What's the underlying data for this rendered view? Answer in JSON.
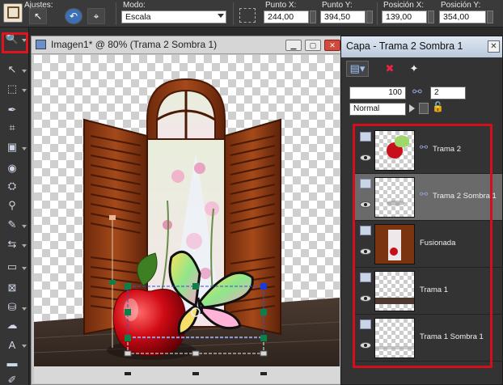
{
  "toolbar": {
    "ajustes_label": "Ajustes:",
    "modo_label": "Modo:",
    "modo_value": "Escala",
    "punto_x_label": "Punto X:",
    "punto_x_value": "244,00",
    "punto_y_label": "Punto Y:",
    "punto_y_value": "394,50",
    "posicion_x_label": "Posición X:",
    "posicion_x_value": "139,00",
    "posicion_y_label": "Posición Y:",
    "posicion_y_value": "354,00"
  },
  "tools": [
    {
      "name": "zoom-icon",
      "glyph": "🔍"
    },
    {
      "name": "pick-tool-icon",
      "glyph": "↖"
    },
    {
      "name": "selection-icon",
      "glyph": "⬚"
    },
    {
      "name": "dropper-icon",
      "glyph": "✒"
    },
    {
      "name": "crop-icon",
      "glyph": "⌗"
    },
    {
      "name": "straighten-icon",
      "glyph": "▣"
    },
    {
      "name": "red-eye-icon",
      "glyph": "◉"
    },
    {
      "name": "clone-icon",
      "glyph": "⛭"
    },
    {
      "name": "scratch-remover-icon",
      "glyph": "⚲"
    },
    {
      "name": "paint-brush-icon",
      "glyph": "✎"
    },
    {
      "name": "lighten-darken-icon",
      "glyph": "⇆"
    },
    {
      "name": "eraser-icon",
      "glyph": "▭"
    },
    {
      "name": "background-eraser-icon",
      "glyph": "⊠"
    },
    {
      "name": "flood-fill-icon",
      "glyph": "⛁"
    },
    {
      "name": "smudge-icon",
      "glyph": "☁"
    },
    {
      "name": "text-tool-icon",
      "glyph": "A"
    },
    {
      "name": "rectangle-tool-icon",
      "glyph": "▬"
    },
    {
      "name": "pen-tool-icon",
      "glyph": "✐"
    }
  ],
  "image_window": {
    "title": "Imagen1* @  80% (Trama 2 Sombra 1)"
  },
  "layers_panel": {
    "title": "Capa - Trama 2 Sombra 1",
    "opacity": "100",
    "link_set": "2",
    "blend_mode": "Normal",
    "layers": [
      {
        "name": "Trama 2",
        "selected": false,
        "linked": true
      },
      {
        "name": "Trama 2 Sombra 1",
        "selected": true,
        "linked": true
      },
      {
        "name": "Fusionada",
        "selected": false,
        "linked": false
      },
      {
        "name": "Trama 1",
        "selected": false,
        "linked": false
      },
      {
        "name": "Trama 1 Sombra 1",
        "selected": false,
        "linked": false
      }
    ]
  },
  "colors": {
    "highlight_red": "#e0141e",
    "wood": "#8b3a12",
    "selection_handle": "#0b3bd1"
  }
}
